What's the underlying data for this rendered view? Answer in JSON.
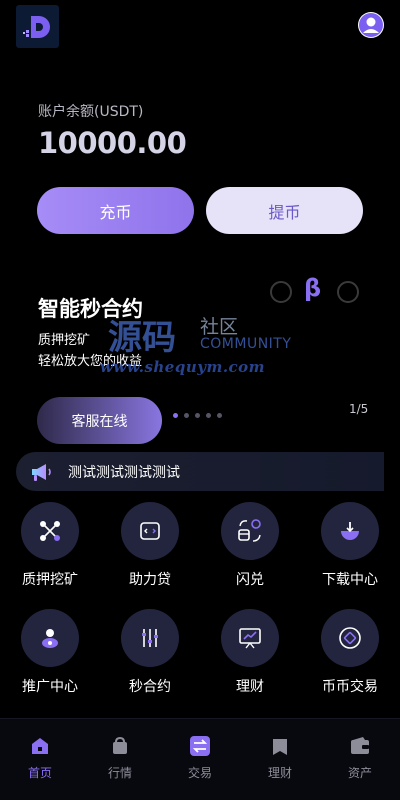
{
  "balance": {
    "label": "账户余额(USDT)",
    "value": "10000.00"
  },
  "actions": {
    "deposit_label": "充币",
    "withdraw_label": "提币"
  },
  "banner": {
    "title": "智能秒合约",
    "line1": "质押挖矿",
    "line2": "轻松放大您的收益",
    "beta_symbol": "β",
    "service_label": "客服在线",
    "pager": "1/5",
    "dots_count": 5,
    "active_dot": 0
  },
  "watermark": {
    "big": "源码",
    "small": "社区",
    "community": "COMMUNITY",
    "url": "www.shequym.com"
  },
  "notice": {
    "text": "测试测试测试测试"
  },
  "grid": {
    "items": [
      {
        "label": "质押挖矿",
        "icon": "mining-icon"
      },
      {
        "label": "助力贷",
        "icon": "loan-icon"
      },
      {
        "label": "闪兑",
        "icon": "flash-swap-icon"
      },
      {
        "label": "下载中心",
        "icon": "download-icon"
      },
      {
        "label": "推广中心",
        "icon": "promotion-icon"
      },
      {
        "label": "秒合约",
        "icon": "contract-icon"
      },
      {
        "label": "理财",
        "icon": "finance-icon"
      },
      {
        "label": "币币交易",
        "icon": "coin-trade-icon"
      }
    ]
  },
  "tabs": [
    {
      "label": "首页",
      "icon": "home-icon",
      "active": true
    },
    {
      "label": "行情",
      "icon": "market-icon",
      "active": false
    },
    {
      "label": "交易",
      "icon": "trade-icon",
      "active": false
    },
    {
      "label": "理财",
      "icon": "wealth-icon",
      "active": false
    },
    {
      "label": "资产",
      "icon": "wallet-icon",
      "active": false
    }
  ],
  "colors": {
    "accent": "#8a6ff2",
    "background": "#000000",
    "circle": "#23253f"
  }
}
